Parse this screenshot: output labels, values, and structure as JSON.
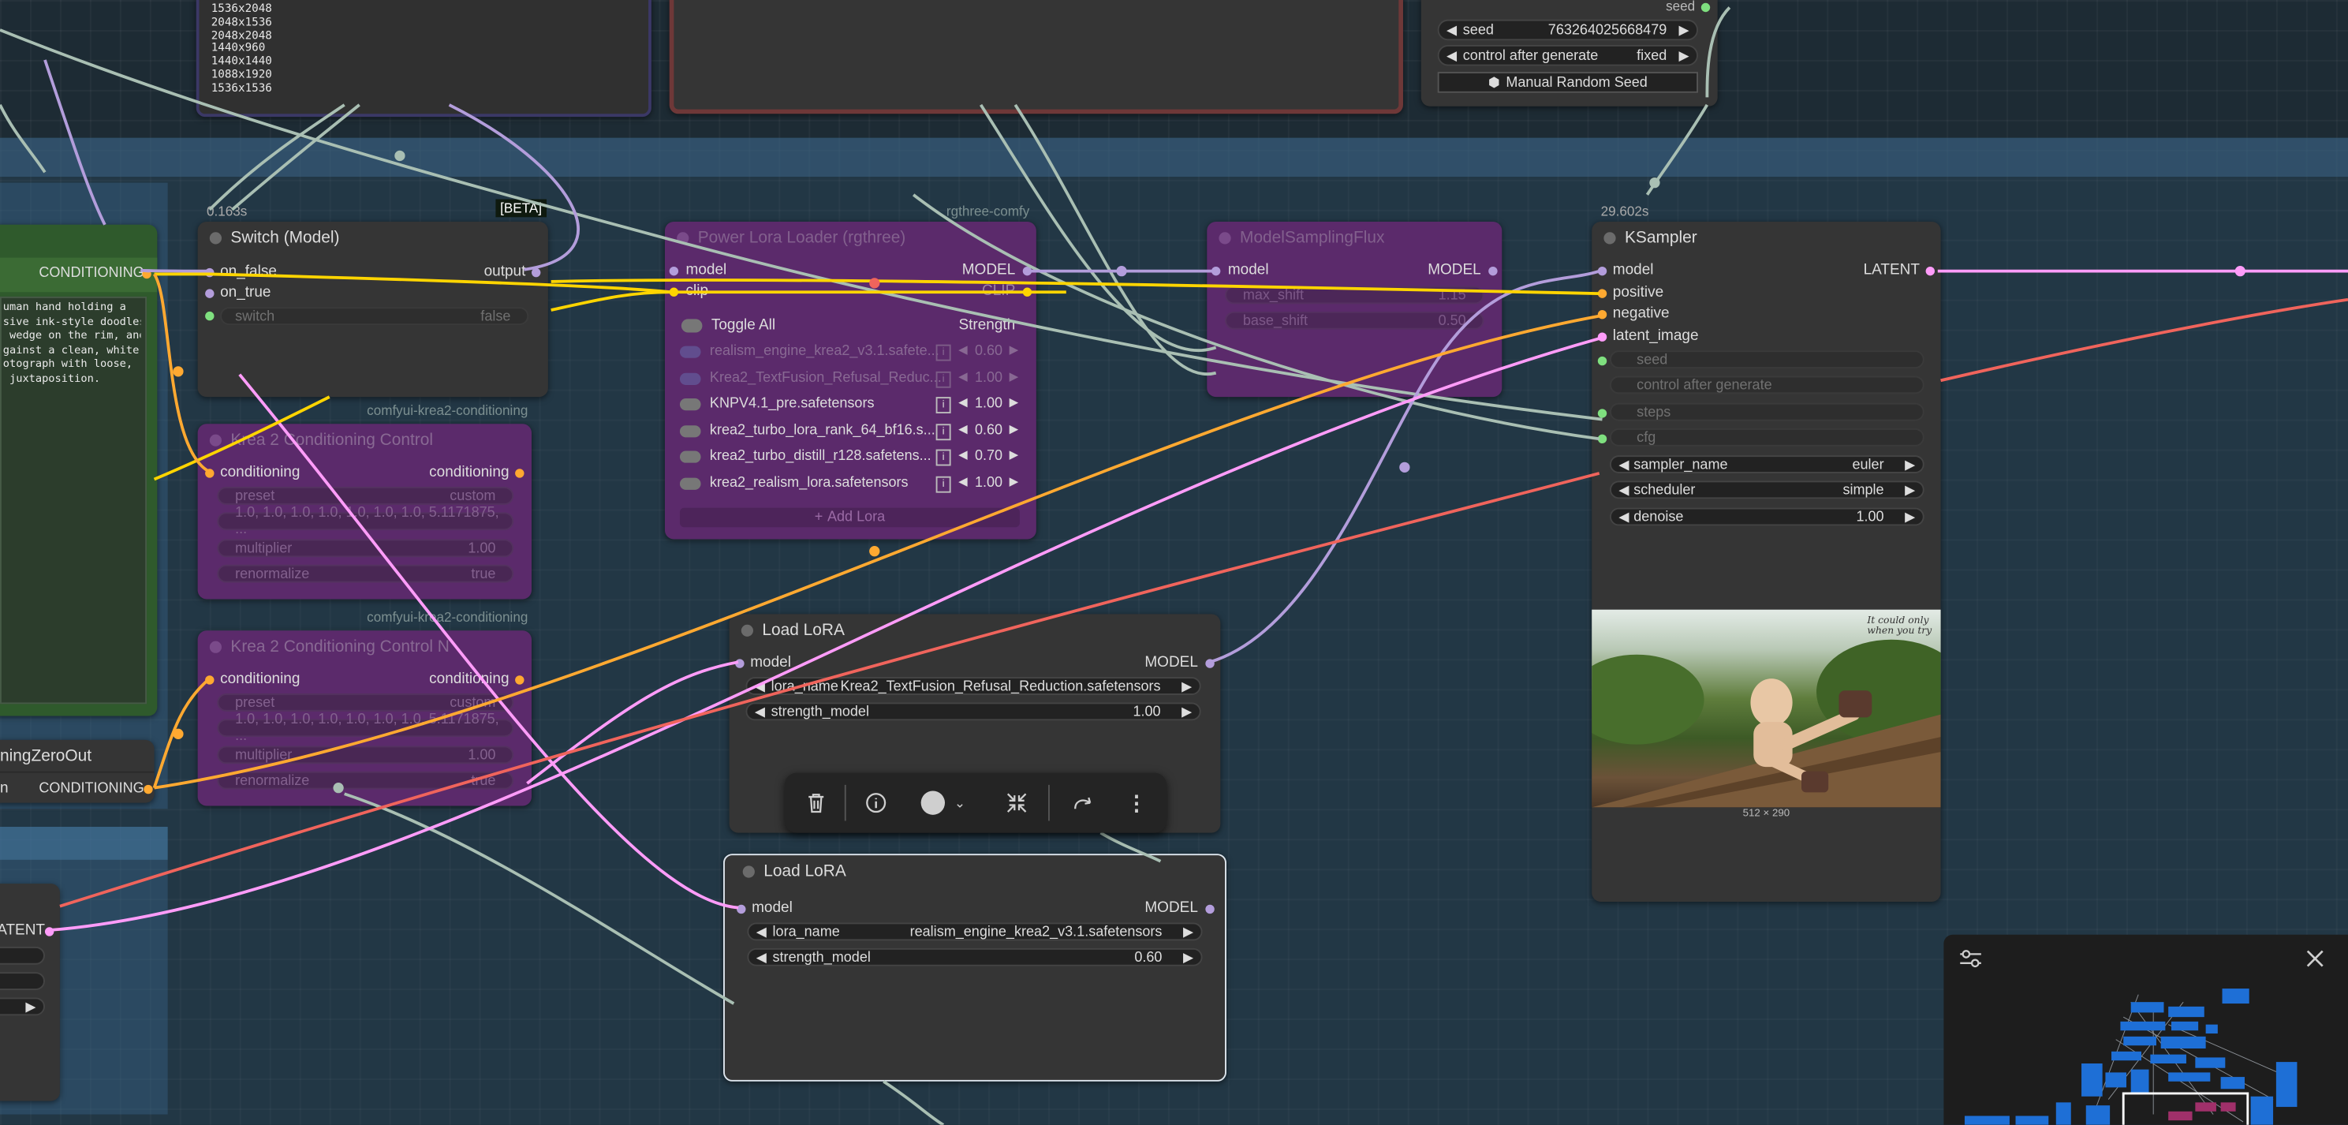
{
  "top_list": {
    "items": [
      "1536x2048",
      "2048x1536",
      "2048x2048",
      "1440x960",
      "1440x1440",
      "1088x1920",
      "1536x1536"
    ]
  },
  "seed_node": {
    "seed_out": "seed",
    "seed_label": "seed",
    "seed_value": "763264025668479",
    "cag_label": "control after generate",
    "cag_value": "fixed",
    "manual_button": "Manual Random Seed"
  },
  "prompt_node": {
    "output": "CONDITIONING",
    "text": "uman hand holding a\nsive ink-style doodles,\n wedge on the rim, and\ngainst a clean, white\notograph with loose,\n juxtaposition."
  },
  "zero_node": {
    "title": "ningZeroOut",
    "in_label": "n",
    "output": "CONDITIONING"
  },
  "latent_node": {
    "output": "ATENT"
  },
  "switch_node": {
    "time": "0.163s",
    "badge": "[BETA]",
    "title": "Switch (Model)",
    "in1": "on_false",
    "in2": "on_true",
    "in3": "switch",
    "out": "output",
    "switch_label": "switch",
    "switch_value": "false"
  },
  "kc1": {
    "group": "comfyui-krea2-conditioning",
    "title": "Krea 2 Conditioning Control",
    "in": "conditioning",
    "out": "conditioning",
    "w1_label": "preset",
    "w1_value": "custom",
    "w2_value": "1.0, 1.0, 1.0, 1.0, 1.0, 1.0, 1.0, 5.1171875, ...",
    "w3_label": "multiplier",
    "w3_value": "1.00",
    "w4_label": "renormalize",
    "w4_value": "true"
  },
  "kc2": {
    "group": "comfyui-krea2-conditioning",
    "title": "Krea 2 Conditioning Control N",
    "in": "conditioning",
    "out": "conditioning",
    "w1_label": "preset",
    "w1_value": "custom",
    "w2_value": "1.0, 1.0, 1.0, 1.0, 1.0, 1.0, 1.0, 5.1171875, ...",
    "w3_label": "multiplier",
    "w3_value": "1.00",
    "w4_label": "renormalize",
    "w4_value": "true"
  },
  "power_lora": {
    "group": "rgthree-comfy",
    "title": "Power Lora Loader (rgthree)",
    "in1": "model",
    "in2": "clip",
    "out1": "MODEL",
    "out2": "CLIP",
    "toggle_all": "Toggle All",
    "strength": "Strength",
    "add_lora": "Add Lora",
    "loras": [
      {
        "name": "realism_engine_krea2_v3.1.safete...",
        "value": "0.60"
      },
      {
        "name": "Krea2_TextFusion_Refusal_Reduc...",
        "value": "1.00"
      },
      {
        "name": "KNPV4.1_pre.safetensors",
        "value": "1.00"
      },
      {
        "name": "krea2_turbo_lora_rank_64_bf16.s...",
        "value": "0.60"
      },
      {
        "name": "krea2_turbo_distill_r128.safetens...",
        "value": "0.70"
      },
      {
        "name": "krea2_realism_lora.safetensors",
        "value": "1.00"
      }
    ]
  },
  "msf": {
    "title": "ModelSamplingFlux",
    "in": "model",
    "out": "MODEL",
    "w1_label": "max_shift",
    "w1_value": "1.15",
    "w2_label": "base_shift",
    "w2_value": "0.50"
  },
  "ksampler": {
    "time": "29.602s",
    "title": "KSampler",
    "in1": "model",
    "in2": "positive",
    "in3": "negative",
    "in4": "latent_image",
    "out": "LATENT",
    "w_seed": "seed",
    "w_cag": "control after generate",
    "w_steps": "steps",
    "w_cfg": "cfg",
    "sampler_label": "sampler_name",
    "sampler_value": "euler",
    "scheduler_label": "scheduler",
    "scheduler_value": "simple",
    "denoise_label": "denoise",
    "denoise_value": "1.00",
    "preview_size": "512 × 290",
    "preview_caption": "It could only\nwhen you try"
  },
  "lora1": {
    "title": "Load LoRA",
    "in": "model",
    "out": "MODEL",
    "name_label": "lora_name",
    "name_value": "Krea2_TextFusion_Refusal_Reduction.safetensors",
    "strength_label": "strength_model",
    "strength_value": "1.00"
  },
  "lora2": {
    "title": "Load LoRA",
    "in": "model",
    "out": "MODEL",
    "name_label": "lora_name",
    "name_value": "realism_engine_krea2_v3.1.safetensors",
    "strength_label": "strength_model",
    "strength_value": "0.60"
  },
  "colors": {
    "model": "#b39ddb",
    "clip": "#ffd500",
    "conditioning": "#ffa931",
    "latent": "#ff9cf9",
    "int": "#7fe07f",
    "link_gray": "#a9bfb3"
  }
}
